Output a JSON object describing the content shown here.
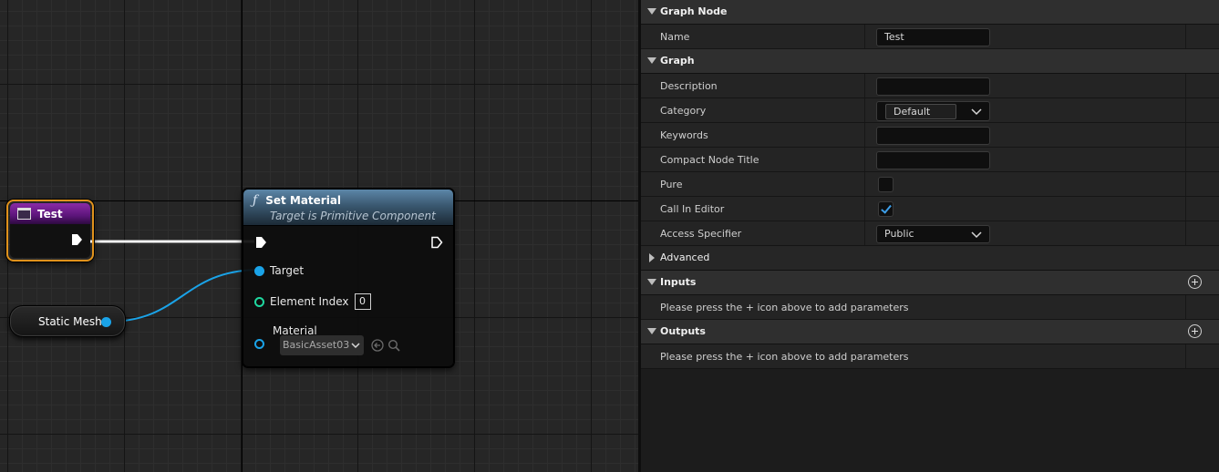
{
  "graph": {
    "test_node": {
      "title": "Test"
    },
    "static_mesh_node": {
      "label": "Static Mesh"
    },
    "set_material_node": {
      "title": "Set Material",
      "subtitle": "Target is Primitive Component",
      "icon": "function-icon",
      "pins": {
        "target": "Target",
        "element_index": "Element Index",
        "element_index_value": "0",
        "material": "Material",
        "material_value": "BasicAsset03"
      }
    },
    "colors": {
      "event_header": "#7a2596",
      "function_header": "#4a7090",
      "object_pin": "#1aa3e8",
      "int_pin": "#1fd8a0",
      "selection": "#e0921c"
    }
  },
  "details": {
    "sections": {
      "graph_node": "Graph Node",
      "graph": "Graph",
      "advanced": "Advanced",
      "inputs": "Inputs",
      "outputs": "Outputs"
    },
    "rows": {
      "name": {
        "label": "Name",
        "value": "Test"
      },
      "description": {
        "label": "Description",
        "value": ""
      },
      "category": {
        "label": "Category",
        "value": "Default"
      },
      "keywords": {
        "label": "Keywords",
        "value": ""
      },
      "compact_node_title": {
        "label": "Compact Node Title",
        "value": ""
      },
      "pure": {
        "label": "Pure",
        "checked": false
      },
      "call_in_editor": {
        "label": "Call In Editor",
        "checked": true
      },
      "access_specifier": {
        "label": "Access Specifier",
        "value": "Public"
      }
    },
    "inputs_message": "Please press the + icon above to add parameters",
    "outputs_message": "Please press the + icon above to add parameters"
  }
}
